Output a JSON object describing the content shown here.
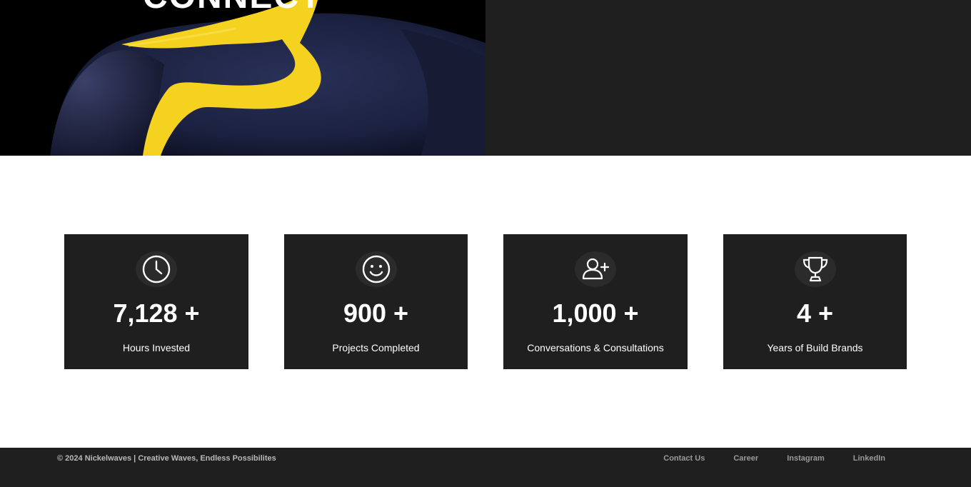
{
  "hero": {
    "title": "CONNECT"
  },
  "stats": [
    {
      "icon": "clock-icon",
      "value": "7,128 +",
      "label": "Hours Invested"
    },
    {
      "icon": "smiley-icon",
      "value": "900 +",
      "label": "Projects Completed"
    },
    {
      "icon": "user-plus-icon",
      "value": "1,000 +",
      "label": "Conversations & Consultations"
    },
    {
      "icon": "trophy-icon",
      "value": "4 +",
      "label": "Years of Build Brands"
    }
  ],
  "footer": {
    "copyright": "© 2024 Nickelwaves | Creative Waves, Endless Possibilites",
    "links": [
      "Contact Us",
      "Career",
      "Instagram",
      "LinkedIn"
    ]
  },
  "colors": {
    "dark_panel": "#1f1f1f",
    "accent_yellow": "#f4d21f",
    "figure_blue": "#1c2240"
  }
}
